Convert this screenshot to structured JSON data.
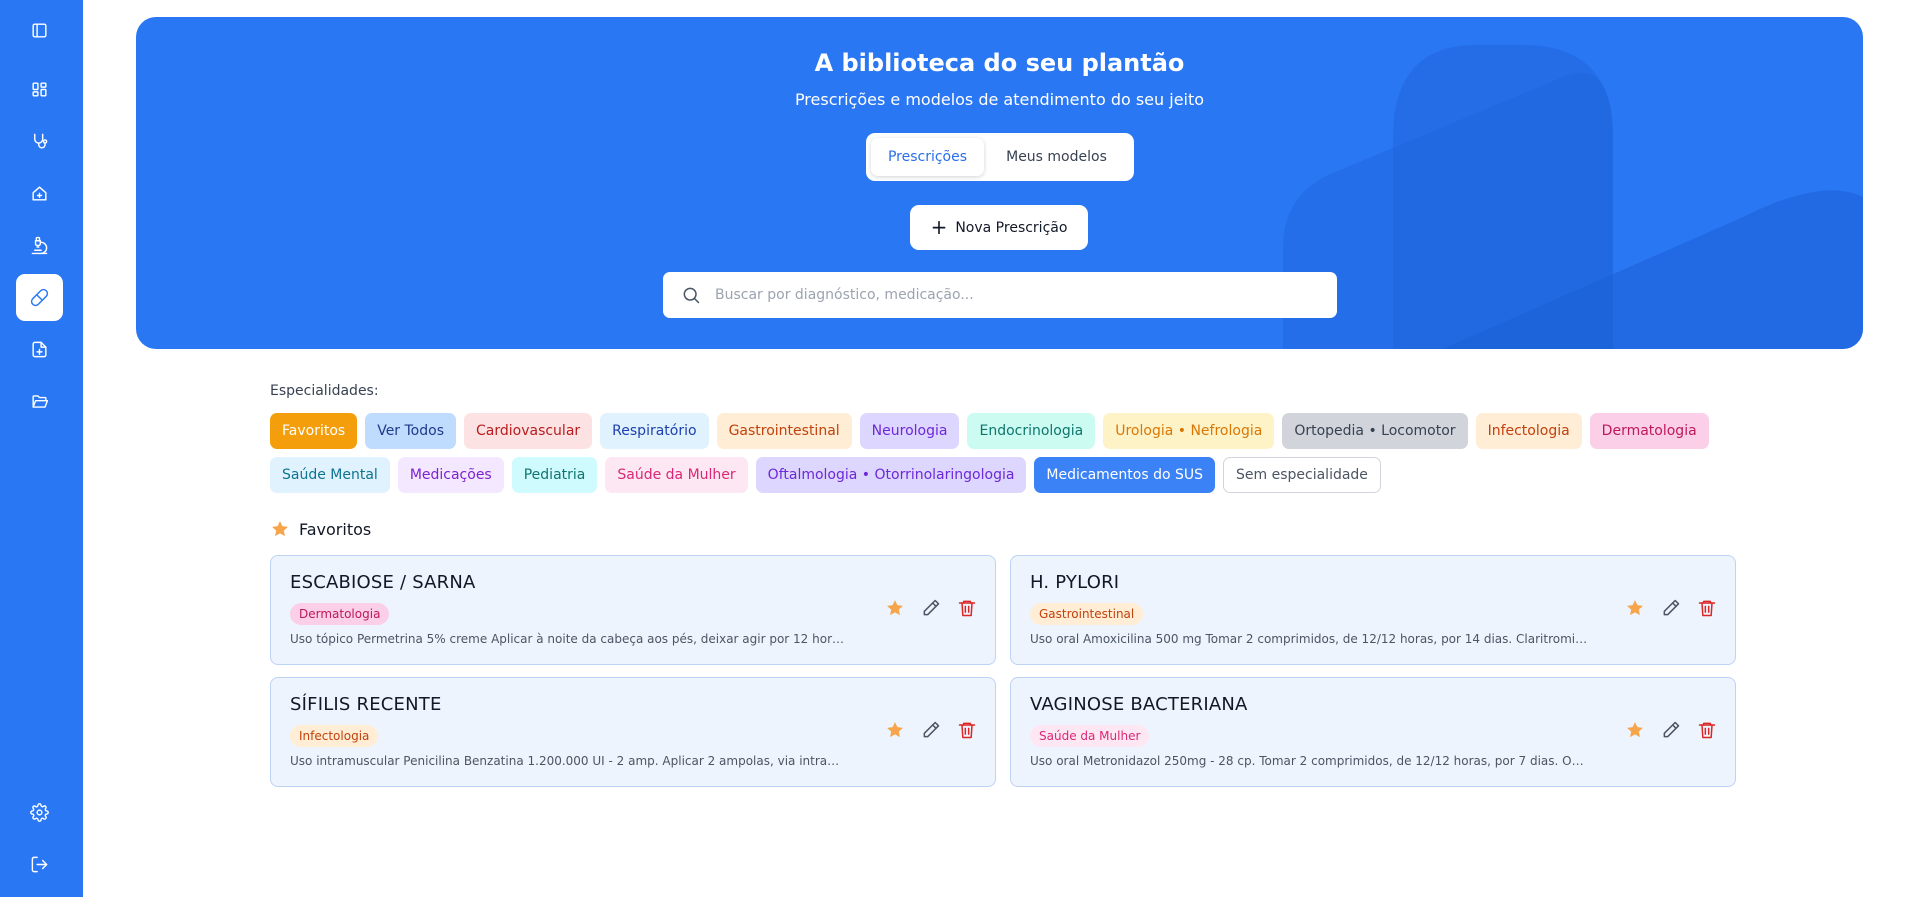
{
  "hero": {
    "title": "A biblioteca do seu plantão",
    "subtitle": "Prescrições e modelos de atendimento do seu jeito",
    "tabs": [
      {
        "label": "Prescrições",
        "active": true
      },
      {
        "label": "Meus modelos",
        "active": false
      }
    ],
    "new_button": "Nova Prescrição",
    "search_placeholder": "Buscar por diagnóstico, medicação..."
  },
  "sidebar": {
    "items": [
      {
        "icon": "sidebar-toggle-icon"
      },
      {
        "icon": "dashboard-icon"
      },
      {
        "icon": "stethoscope-icon"
      },
      {
        "icon": "home-plus-icon"
      },
      {
        "icon": "microscope-icon"
      },
      {
        "icon": "pill-icon",
        "active": true
      },
      {
        "icon": "file-plus-icon"
      },
      {
        "icon": "folder-open-icon"
      }
    ],
    "bottom": [
      {
        "icon": "gear-icon"
      },
      {
        "icon": "logout-icon"
      }
    ]
  },
  "specialties": {
    "label": "Especialidades:",
    "rows": [
      [
        {
          "label": "Favoritos",
          "bg": "#f59e0b",
          "fg": "#ffffff"
        },
        {
          "label": "Ver Todos",
          "bg": "#bfdbfe",
          "fg": "#1e3a8a"
        },
        {
          "label": "Cardiovascular",
          "bg": "#fde2e4",
          "fg": "#b91c1c"
        },
        {
          "label": "Respiratório",
          "bg": "#e0f2fe",
          "fg": "#1e40af"
        },
        {
          "label": "Gastrointestinal",
          "bg": "#ffedd5",
          "fg": "#c2410c"
        },
        {
          "label": "Neurologia",
          "bg": "#ddd6fe",
          "fg": "#6d28d9"
        },
        {
          "label": "Endocrinologia",
          "bg": "#ccfbf1",
          "fg": "#0f766e"
        },
        {
          "label": "Urologia • Nefrologia",
          "bg": "#fef3c7",
          "fg": "#d97706"
        },
        {
          "label": "Ortopedia • Locomotor",
          "bg": "#d1d5db",
          "fg": "#374151"
        },
        {
          "label": "Infectologia",
          "bg": "#ffedd5",
          "fg": "#c2410c"
        },
        {
          "label": "Dermatologia",
          "bg": "#fbcfe8",
          "fg": "#be185d"
        }
      ],
      [
        {
          "label": "Saúde Mental",
          "bg": "#e0f2fe",
          "fg": "#0e7490"
        },
        {
          "label": "Medicações",
          "bg": "#f3e8ff",
          "fg": "#7e22ce"
        },
        {
          "label": "Pediatria",
          "bg": "#cffafe",
          "fg": "#0f766e"
        },
        {
          "label": "Saúde da Mulher",
          "bg": "#fce7f3",
          "fg": "#db2777"
        },
        {
          "label": "Oftalmologia • Otorrinolaringologia",
          "bg": "#ddd6fe",
          "fg": "#6d28d9"
        },
        {
          "label": "Medicamentos do SUS",
          "bg": "#3b82f6",
          "fg": "#ffffff"
        },
        {
          "label": "Sem especialidade",
          "bg": "#ffffff",
          "fg": "#4b5563",
          "border": "#d1d5db"
        }
      ]
    ]
  },
  "favorites": {
    "title": "Favoritos",
    "cards": [
      {
        "title": "ESCABIOSE / SARNA",
        "tag": "Dermatologia",
        "tag_bg": "#fbcfe8",
        "tag_fg": "#be185d",
        "desc": "Uso tópico Permetrina 5% creme Aplicar à noite da cabeça aos pés, deixar agir por 12 horas..."
      },
      {
        "title": "H. PYLORI",
        "tag": "Gastrointestinal",
        "tag_bg": "#ffedd5",
        "tag_fg": "#c2410c",
        "desc": "Uso oral Amoxicilina 500 mg Tomar 2 comprimidos, de 12/12 horas, por 14 dias. Claritromici..."
      },
      {
        "title": "SÍFILIS RECENTE",
        "tag": "Infectologia",
        "tag_bg": "#ffedd5",
        "tag_fg": "#c2410c",
        "desc": "Uso intramuscular Penicilina Benzatina 1.200.000 UI - 2 amp. Aplicar 2 ampolas, via intram..."
      },
      {
        "title": "VAGINOSE BACTERIANA",
        "tag": "Saúde da Mulher",
        "tag_bg": "#fce7f3",
        "tag_fg": "#db2777",
        "desc": "Uso oral Metronidazol 250mg - 28 cp. Tomar 2 comprimidos, de 12/12 horas, por 7 dias. Obse..."
      }
    ]
  },
  "colors": {
    "primary": "#2a77f4",
    "star": "#f6a54b",
    "delete": "#dc2626"
  }
}
